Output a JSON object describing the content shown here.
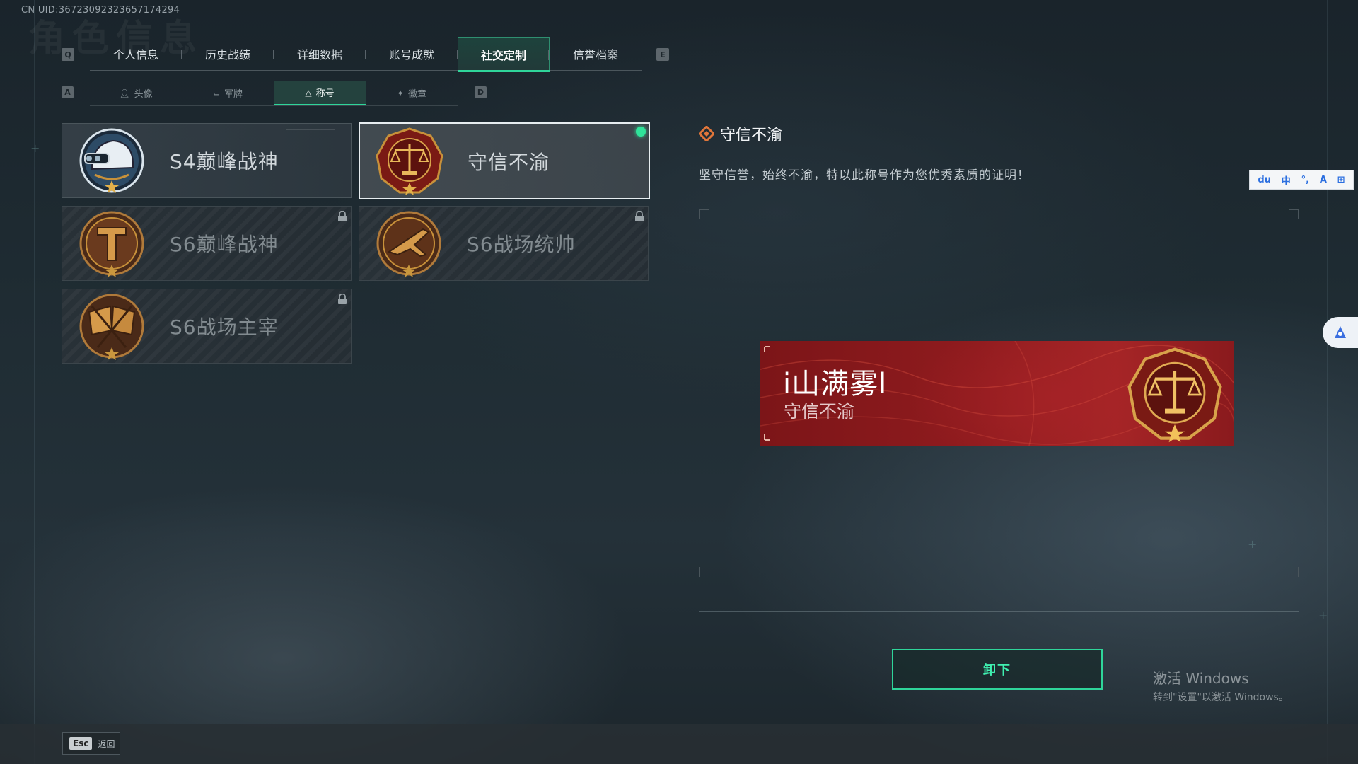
{
  "uid_text": "CN UID:367230923236571742​94",
  "page_ghost_title": "角色信息",
  "main_tabs": {
    "left_key": "Q",
    "right_key": "E",
    "items": [
      {
        "label": "个人信息"
      },
      {
        "label": "历史战绩"
      },
      {
        "label": "详细数据"
      },
      {
        "label": "账号成就"
      },
      {
        "label": "社交定制",
        "active": true
      },
      {
        "label": "信誉档案"
      }
    ]
  },
  "sub_tabs": {
    "left_key": "A",
    "right_key": "D",
    "items": [
      {
        "label": "头像",
        "icon": "person-icon"
      },
      {
        "label": "军牌",
        "icon": "dogtag-icon"
      },
      {
        "label": "称号",
        "icon": "title-icon",
        "active": true
      },
      {
        "label": "徽章",
        "icon": "badge-icon"
      }
    ]
  },
  "titles": [
    {
      "label": "S4巅峰战神",
      "emblem": "helmet-emblem",
      "locked": false,
      "selected": false
    },
    {
      "label": "守信不渝",
      "emblem": "scales-emblem",
      "locked": false,
      "selected": true,
      "equipped": true
    },
    {
      "label": "S6巅峰战神",
      "emblem": "t-shield-emblem",
      "locked": true
    },
    {
      "label": "S6战场统帅",
      "emblem": "jet-emblem",
      "locked": true
    },
    {
      "label": "S6战场主宰",
      "emblem": "crossed-flags-emblem",
      "locked": true
    }
  ],
  "detail": {
    "title": "守信不渝",
    "description": "坚守信誉，始终不渝，特以此称号作为您优秀素质的证明！"
  },
  "preview": {
    "player_name": "i山满雾l",
    "title_text": "守信不渝"
  },
  "action_button": "卸下",
  "footer": {
    "esc_key": "Esc",
    "back_label": "返回"
  },
  "windows_watermark": {
    "line1": "激活 Windows",
    "line2": "转到\"设置\"以激活 Windows。"
  },
  "ime_toolbar": {
    "items": [
      "du",
      "中",
      "°,",
      "A",
      "⊞"
    ]
  },
  "colors": {
    "accent_green": "#2fd59a",
    "banner_red": "#8f1b1e",
    "emblem_gold": "#c8913a"
  }
}
